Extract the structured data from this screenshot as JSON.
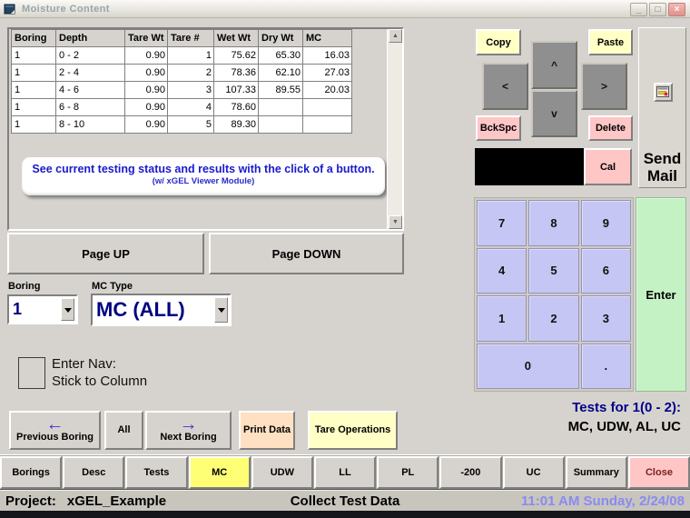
{
  "window": {
    "title": "Moisture Content",
    "minimize_glyph": "_",
    "restore_glyph": "□",
    "close_glyph": "×"
  },
  "table": {
    "headers": [
      "Boring",
      "Depth",
      "Tare Wt",
      "Tare #",
      "Wet Wt",
      "Dry Wt",
      "MC"
    ],
    "rows": [
      [
        "1",
        "0 - 2",
        "0.90",
        "1",
        "75.62",
        "65.30",
        "16.03"
      ],
      [
        "1",
        "2 - 4",
        "0.90",
        "2",
        "78.36",
        "62.10",
        "27.03"
      ],
      [
        "1",
        "4 - 6",
        "0.90",
        "3",
        "107.33",
        "89.55",
        "20.03"
      ],
      [
        "1",
        "6 - 8",
        "0.90",
        "4",
        "78.60",
        "",
        ""
      ],
      [
        "1",
        "8 - 10",
        "0.90",
        "5",
        "89.30",
        "",
        ""
      ]
    ]
  },
  "banner": {
    "line1": "See current testing status and results with the click of a button.",
    "line2": "(w/ xGEL Viewer Module)"
  },
  "paging": {
    "up": "Page UP",
    "down": "Page DOWN"
  },
  "filters": {
    "boring_label": "Boring",
    "boring_value": "1",
    "mc_type_label": "MC Type",
    "mc_type_value": "MC (ALL)"
  },
  "enter_nav": {
    "line1": "Enter Nav:",
    "line2": "Stick to Column"
  },
  "actions": {
    "prev_arrow_glyph": "←",
    "previous_boring": "Previous Boring",
    "all": "All",
    "next_arrow_glyph": "→",
    "next_boring": "Next Boring",
    "print_data": "Print Data",
    "tare_operations": "Tare Operations"
  },
  "edit_pad": {
    "copy": "Copy",
    "paste": "Paste",
    "up": "^",
    "down": "v",
    "left": "<",
    "right": ">",
    "backspace": "BckSpc",
    "delete": "Delete",
    "cal": "Cal",
    "send_mail": "Send Mail"
  },
  "keypad": {
    "keys": [
      "7",
      "8",
      "9",
      "4",
      "5",
      "6",
      "1",
      "2",
      "3",
      "0",
      "."
    ],
    "enter": "Enter"
  },
  "tests": {
    "title": "Tests for 1(0 - 2):",
    "list": "MC, UDW, AL, UC"
  },
  "tabs": [
    {
      "label": "Borings"
    },
    {
      "label": "Desc"
    },
    {
      "label": "Tests"
    },
    {
      "label": "MC"
    },
    {
      "label": "UDW"
    },
    {
      "label": "LL"
    },
    {
      "label": "PL"
    },
    {
      "label": "-200"
    },
    {
      "label": "UC"
    },
    {
      "label": "Summary"
    },
    {
      "label": "Close"
    }
  ],
  "status": {
    "project_label": "Project:",
    "project_name": "xGEL_Example",
    "mode": "Collect Test Data",
    "datetime": "11:01 AM Sunday, 2/24/08"
  },
  "scrollbar": {
    "up_glyph": "▲",
    "down_glyph": "▼"
  },
  "colors": {
    "yellow_button": "#ffffc6",
    "pink_button": "#ffc6c6",
    "peach_button": "#ffe0c2",
    "keypad_key": "#c6c6f4",
    "enter_key": "#c4f2c4",
    "active_tab": "#ffff76",
    "banner_text": "#1a1acd",
    "combo_text": "#000080",
    "datetime_text": "#8a8af2",
    "window_bg": "#d6d3ce"
  }
}
